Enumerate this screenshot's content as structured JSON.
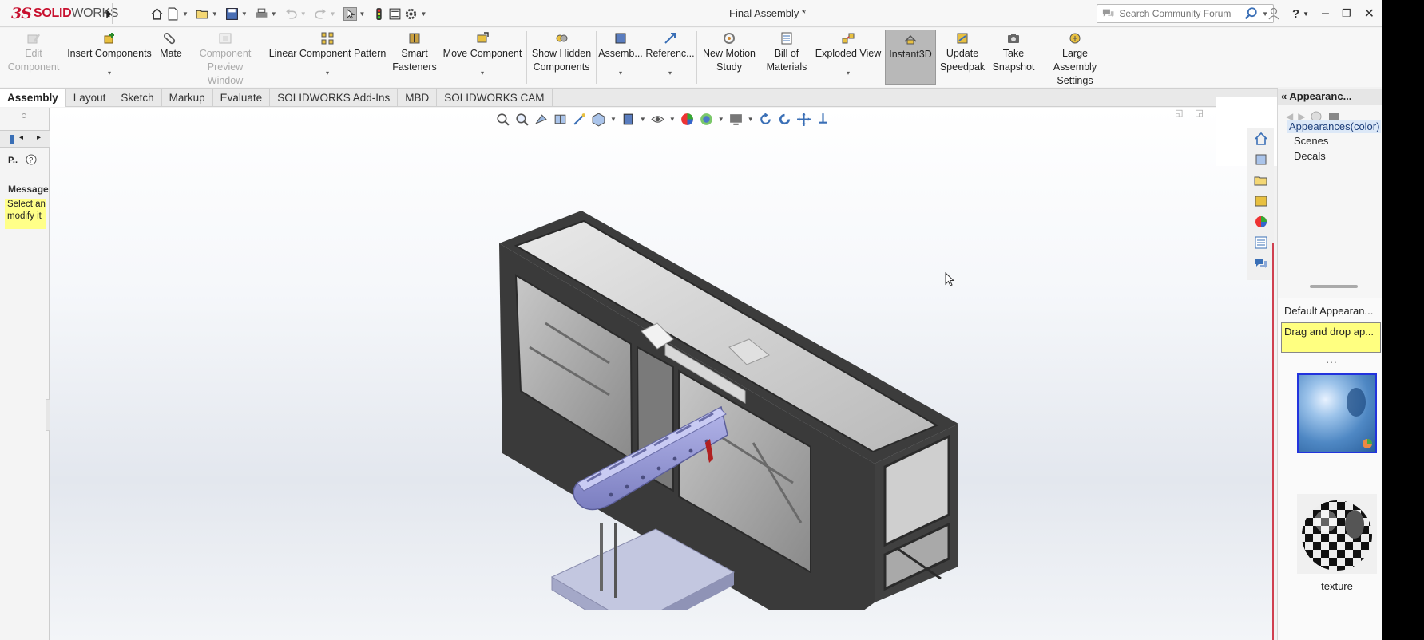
{
  "window": {
    "title": "Final Assembly *",
    "logo_ds": "3S",
    "logo_text_a": "SOLID",
    "logo_text_b": "WORKS"
  },
  "search": {
    "placeholder": "Search Community Forum"
  },
  "ribbon": {
    "commands": [
      {
        "l1": "Edit",
        "l2": "Component",
        "icon": "edit-component-icon",
        "disabled": true
      },
      {
        "l1": "Insert Components",
        "l2": "",
        "icon": "insert-components-icon"
      },
      {
        "l1": "Mate",
        "l2": "",
        "icon": "mate-icon"
      },
      {
        "l1": "Component",
        "l2": "Preview Window",
        "icon": "preview-window-icon",
        "disabled": true
      },
      {
        "l1": "Linear Component Pattern",
        "l2": "",
        "icon": "linear-pattern-icon"
      },
      {
        "l1": "Smart",
        "l2": "Fasteners",
        "icon": "smart-fasteners-icon"
      },
      {
        "l1": "Move Component",
        "l2": "",
        "icon": "move-component-icon"
      },
      {
        "l1": "Show Hidden",
        "l2": "Components",
        "icon": "show-hidden-icon"
      },
      {
        "l1": "Assemb...",
        "l2": "",
        "icon": "assembly-features-icon"
      },
      {
        "l1": "Referenc...",
        "l2": "",
        "icon": "reference-geometry-icon"
      },
      {
        "l1": "New Motion",
        "l2": "Study",
        "icon": "motion-study-icon"
      },
      {
        "l1": "Bill of",
        "l2": "Materials",
        "icon": "bom-icon"
      },
      {
        "l1": "Exploded View",
        "l2": "",
        "icon": "exploded-view-icon"
      },
      {
        "l1": "Instant3D",
        "l2": "",
        "icon": "instant3d-icon"
      },
      {
        "l1": "Update",
        "l2": "Speedpak",
        "icon": "speedpak-icon"
      },
      {
        "l1": "Take",
        "l2": "Snapshot",
        "icon": "snapshot-icon"
      },
      {
        "l1": "Large Assembly",
        "l2": "Settings",
        "icon": "large-assembly-icon"
      }
    ]
  },
  "tabs": [
    "Assembly",
    "Layout",
    "Sketch",
    "Markup",
    "Evaluate",
    "SOLIDWORKS Add-Ins",
    "MBD",
    "SOLIDWORKS CAM"
  ],
  "active_tab": "Assembly",
  "leftpanel": {
    "short_label": "P..",
    "message_title": "Message",
    "message_text": "Select an modify it"
  },
  "rightpanel": {
    "header": "Appearanc...",
    "tree": [
      "Appearances(color)",
      "Scenes",
      "Decals"
    ],
    "default_label": "Default Appearan...",
    "tip": "Drag and drop ap...",
    "dots": "...",
    "swatch2_label": "texture"
  },
  "colors": {
    "brand_red": "#c8102e",
    "frame_dark": "#3a3a3a",
    "conveyor": "#9c9ed8",
    "base_plate": "#bfc3dc"
  }
}
